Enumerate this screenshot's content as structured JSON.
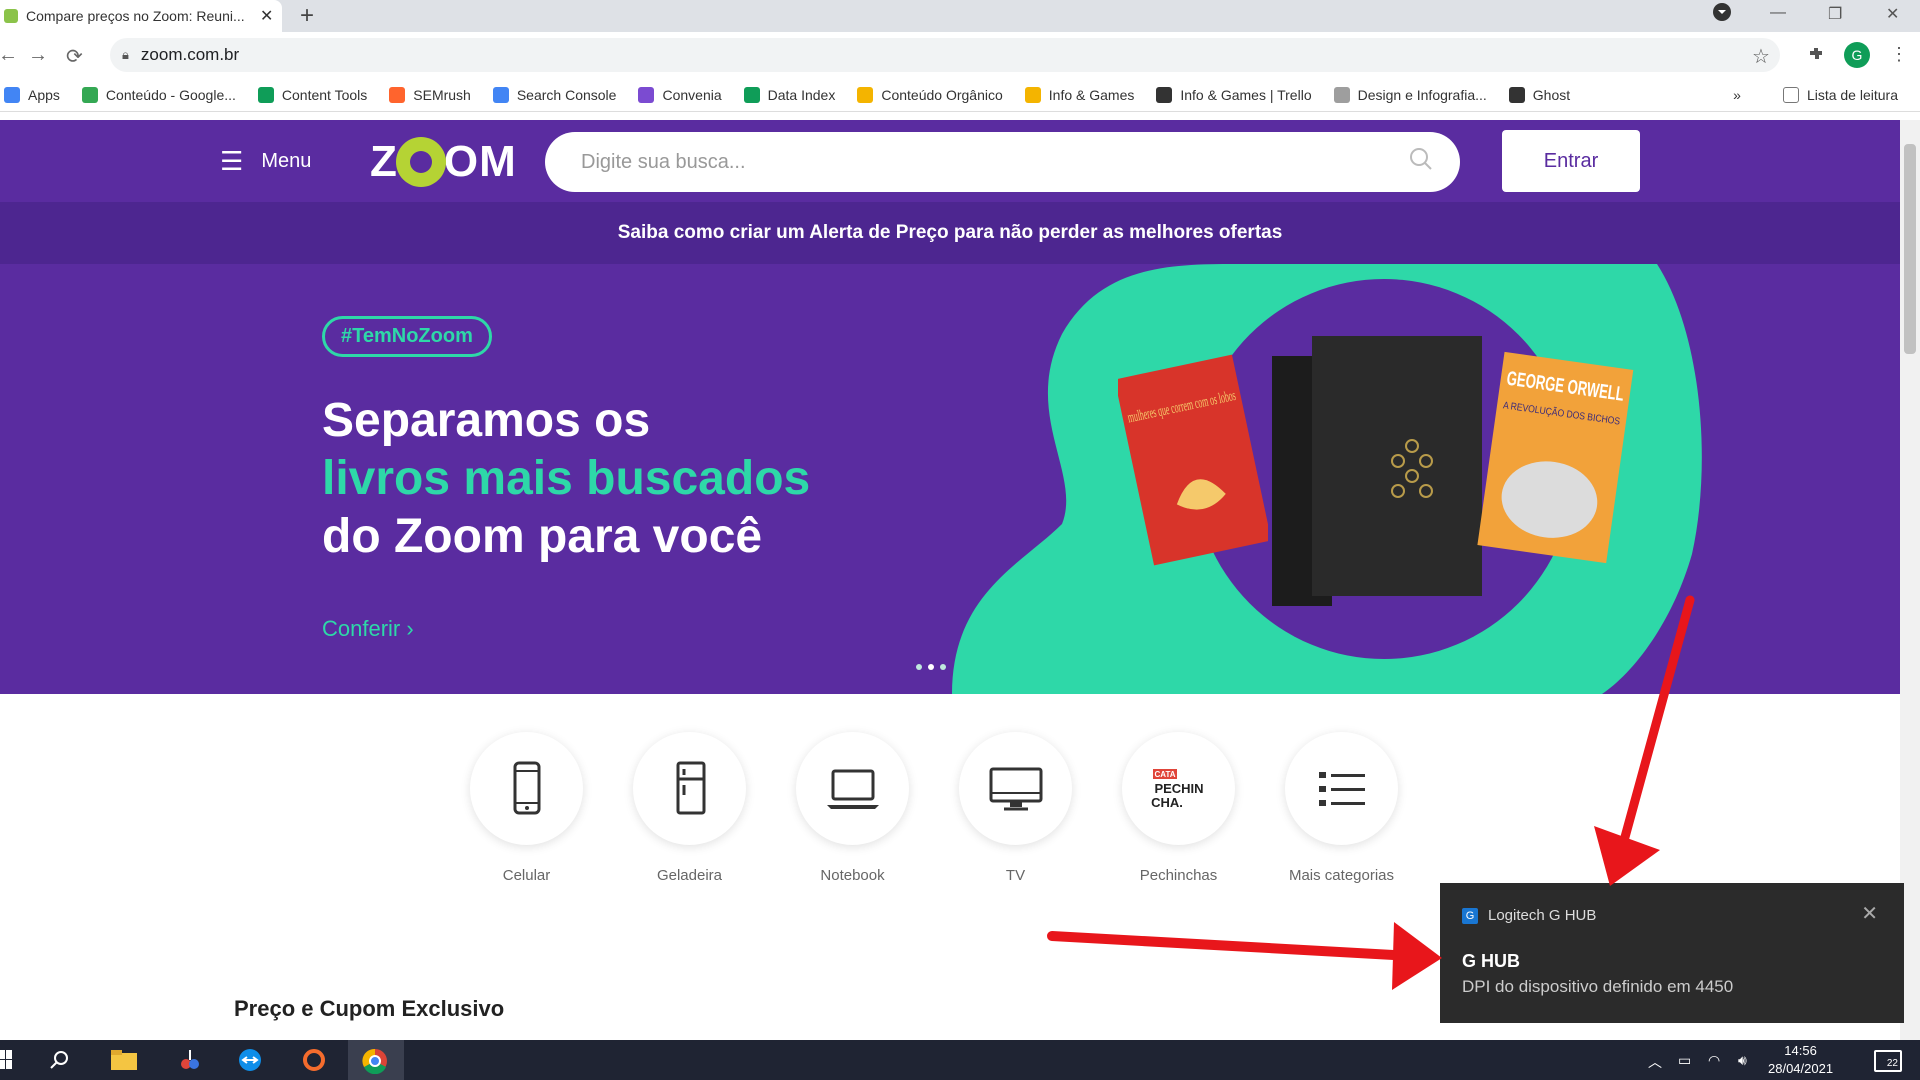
{
  "browser": {
    "tab_title": "Compare preços no Zoom: Reuni...",
    "tab_close": "✕",
    "new_tab": "+",
    "url": "zoom.com.br",
    "bookmarks": [
      {
        "label": "Apps",
        "color": "#4285f4"
      },
      {
        "label": "Conteúdo - Google...",
        "color": "#34a853"
      },
      {
        "label": "Content Tools",
        "color": "#0f9d58"
      },
      {
        "label": "SEMrush",
        "color": "#ff642d"
      },
      {
        "label": "Search Console",
        "color": "#4285f4"
      },
      {
        "label": "Convenia",
        "color": "#7b4bd1"
      },
      {
        "label": "Data Index",
        "color": "#0f9d58"
      },
      {
        "label": "Conteúdo Orgânico",
        "color": "#f4b400"
      },
      {
        "label": "Info & Games",
        "color": "#f4b400"
      },
      {
        "label": "Info & Games | Trello",
        "color": "#333333"
      },
      {
        "label": "Design e Infografia...",
        "color": "#9e9e9e"
      },
      {
        "label": "Ghost",
        "color": "#333333"
      }
    ],
    "bookmarks_more": "»",
    "reading_list": "Lista de leitura"
  },
  "header": {
    "menu_label": "Menu",
    "logo_text_left": "Z",
    "logo_text_right": "OM",
    "search_placeholder": "Digite sua busca...",
    "login_label": "Entrar"
  },
  "promo_bar": "Saiba como criar um Alerta de Preço para não perder as melhores ofertas",
  "hero": {
    "tag": "#TemNoZoom",
    "line1": "Separamos os",
    "line2": "livros mais buscados",
    "line3": "do Zoom para você",
    "cta": "Conferir ›",
    "book1_title": "mulheres que correm com os lobos",
    "book3_title": "GEORGE ORWELL",
    "book3_sub": "A REVOLUÇÃO DOS BICHOS"
  },
  "categories": [
    {
      "label": "Celular",
      "icon": "smartphone-icon"
    },
    {
      "label": "Geladeira",
      "icon": "fridge-icon"
    },
    {
      "label": "Notebook",
      "icon": "laptop-icon"
    },
    {
      "label": "TV",
      "icon": "tv-icon"
    },
    {
      "label": "Pechinchas",
      "icon": "pechinchas-icon"
    },
    {
      "label": "Mais categorias",
      "icon": "list-icon"
    }
  ],
  "pechinchas_icon_text": {
    "top": "CATA",
    "mid": "PECHIN",
    "bot": "CHA."
  },
  "section_title": "Preço e Cupom Exclusivo",
  "notification": {
    "app": "Logitech G HUB",
    "title": "G HUB",
    "message": "DPI do dispositivo definido em 4450",
    "close": "✕"
  },
  "taskbar": {
    "time": "14:56",
    "date": "28/04/2021",
    "notif_count": "22"
  },
  "colors": {
    "brand_purple": "#5a2ca0",
    "brand_green": "#2ed8a8",
    "logo_lime": "#b5d334",
    "arrow_red": "#e8161b"
  }
}
